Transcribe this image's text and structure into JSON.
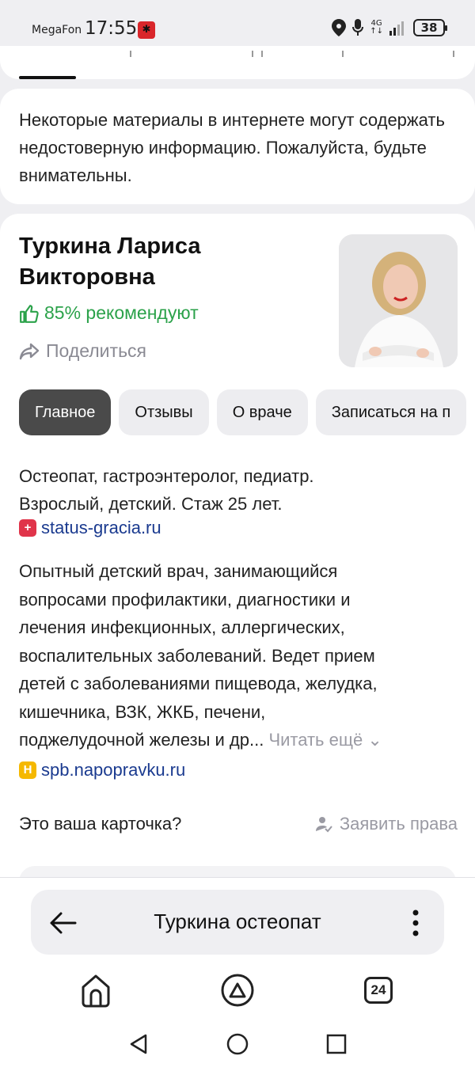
{
  "status_bar": {
    "carrier": "MegaFon",
    "time": "17:55",
    "network": "4G",
    "battery": "38"
  },
  "warning": {
    "text": "Некоторые материалы в интернете могут содержать недостоверную информацию. Пожалуйста, будьте внимательны."
  },
  "doctor": {
    "name_line1": "Туркина Лариса",
    "name_line2": "Викторовна",
    "recommend": "85% рекомендуют",
    "share": "Поделиться",
    "tabs": [
      "Главное",
      "Отзывы",
      "О враче",
      "Записаться на п"
    ],
    "specialty_line1": "Остеопат, гастроэнтеролог, педиатр.",
    "specialty_line2": "Взрослый, детский. Стаж 25 лет.",
    "source1": "status-gracia.ru",
    "description_lines": [
      "Опытный детский врач, занимающийся",
      "вопросами профилактики, диагностики и",
      "лечения инфекционных, аллергических,",
      "воспалительных заболеваний. Ведет прием",
      "детей с заболеваниями пищевода, желудка,",
      "кишечника, ВЗК, ЖКБ, печени,",
      "поджелудочной железы и др..."
    ],
    "read_more": "Читать ещё",
    "source2": "spb.napopravku.ru",
    "source2_badge": "Н",
    "claim_question": "Это ваша карточка?",
    "claim_action": "Заявить права"
  },
  "browser": {
    "query": "Туркина остеопат",
    "tabs_count": "24"
  },
  "colors": {
    "accent_green": "#2ba24a",
    "link_blue": "#1a3a8f",
    "active_tab": "#4a4a4a"
  }
}
